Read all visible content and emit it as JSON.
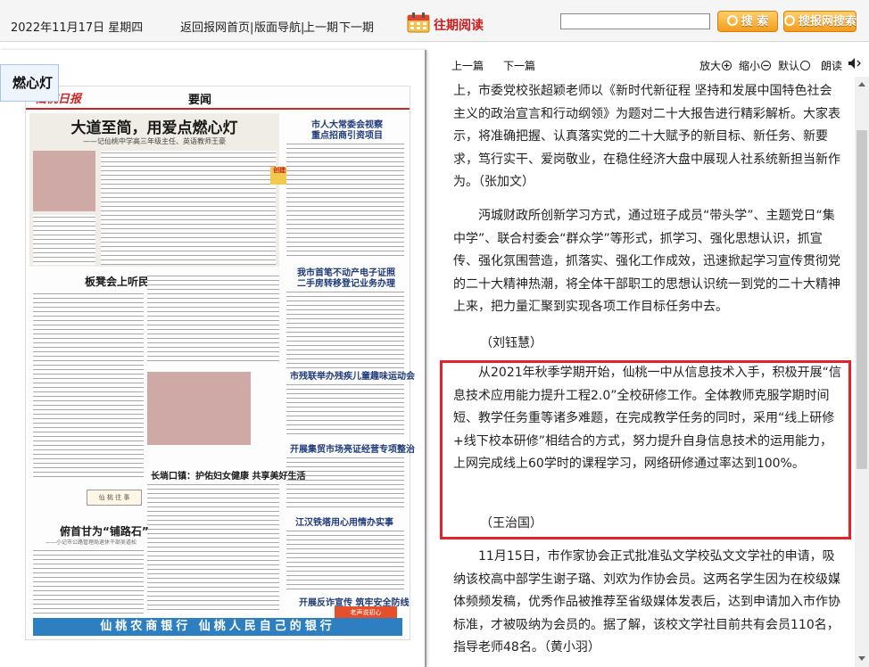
{
  "topbar": {
    "date": "2022年11月17日 星期四",
    "home_link": "返回报网首页|",
    "nav_link": "版面导航|",
    "prev_issue": "上一期",
    "next_issue": "下一期",
    "past_reading": "往期阅读",
    "search_placeholder": "",
    "search_button": "搜 索",
    "site_search_button": "搜报网搜索"
  },
  "left_pane": {
    "title_tag": "燃心灯",
    "newspaper": {
      "logo": "仙桃日报",
      "section": "要闻",
      "headline": "大道至简，用爱点燃心灯",
      "subheadline": "——记仙桃中学高三年级主任、英语教师王豪",
      "col_h1": "市人大常委会视察",
      "col_h2": "重点招商引资项目",
      "col_h3": "我市首笔不动产电子证照",
      "col_h4": "二手房转移登记业务办理",
      "col_h5": "市残联举办残疾儿童趣味运动会",
      "col_h6": "开展集贸市场亮证经营专项整治",
      "col_h7": "江汉铁塔用心用情办实事",
      "col_h8": "开展反诈宣传 筑牢安全防线",
      "story1": "板凳会上听民声",
      "story2": "长埫口镇：护佑妇女健康 共享美好生活",
      "story3": "俯首甘为“铺路石”",
      "story3_sub": "——小记市公路管理局退休干部吴道松",
      "badge": "创建全员 公益 合力",
      "stamp": "老声说初心",
      "ad": "仙桃农商银行 仙桃人民自己的银行"
    }
  },
  "right_pane": {
    "toolbar": {
      "prev_article": "上一篇",
      "next_article": "下一篇",
      "zoom_in": "放大",
      "zoom_out": "缩小",
      "default": "默认",
      "read_aloud": "朗读"
    },
    "article": {
      "p1": "上，市委党校张超颖老师以《新时代新征程 坚持和发展中国特色社会主义的政治宣言和行动纲领》为题对二十大报告进行精彩解析。大家表示，将准确把握、认真落实党的二十大赋予的新目标、新任务、新要求，笃行实干、爱岗敬业，在稳住经济大盘中展现人社系统新担当新作为。（张加文）",
      "p2": "沔城财政所创新学习方式，通过班子成员“带头学”、主题党日“集中学”、联合村委会“群众学”等形式，抓学习、强化思想认识，抓宣传、强化氛围营造，抓落实、强化工作成效，迅速掀起学习宣传贯彻党的二十大精神热潮，将全体干部职工的思想认识统一到党的二十大精神上来，把力量汇聚到实现各项工作目标任务中去。",
      "p2_sign": "（刘钰慧）",
      "p3": "从2021年秋季学期开始，仙桃一中从信息技术入手，积极开展“信息技术应用能力提升工程2.0”全校研修工作。全体教师克服学期时间短、教学任务重等诸多难题，在完成教学任务的同时，采用“线上研修+线下校本研修”相结合的方式，努力提升自身信息技术的运用能力，上网完成线上60学时的课程学习，网络研修通过率达到100%。",
      "p3_sign": "（王治国）",
      "p4": "11月15日，市作家协会正式批准弘文学校弘文文学社的申请，吸纳该校高中部学生谢子璐、刘欢为作协会员。这两名学生因为在校级媒体频频发稿，优秀作品被推荐至省级媒体发表后，达到申请加入市作协标准，才被吸纳为会员的。据了解，该校文学社目前共有会员110名，指导老师48名。（黄小羽）"
    }
  },
  "colors": {
    "accent_red": "#e3242b",
    "button_orange": "#f49c1c",
    "ad_blue": "#2d7fc1"
  }
}
